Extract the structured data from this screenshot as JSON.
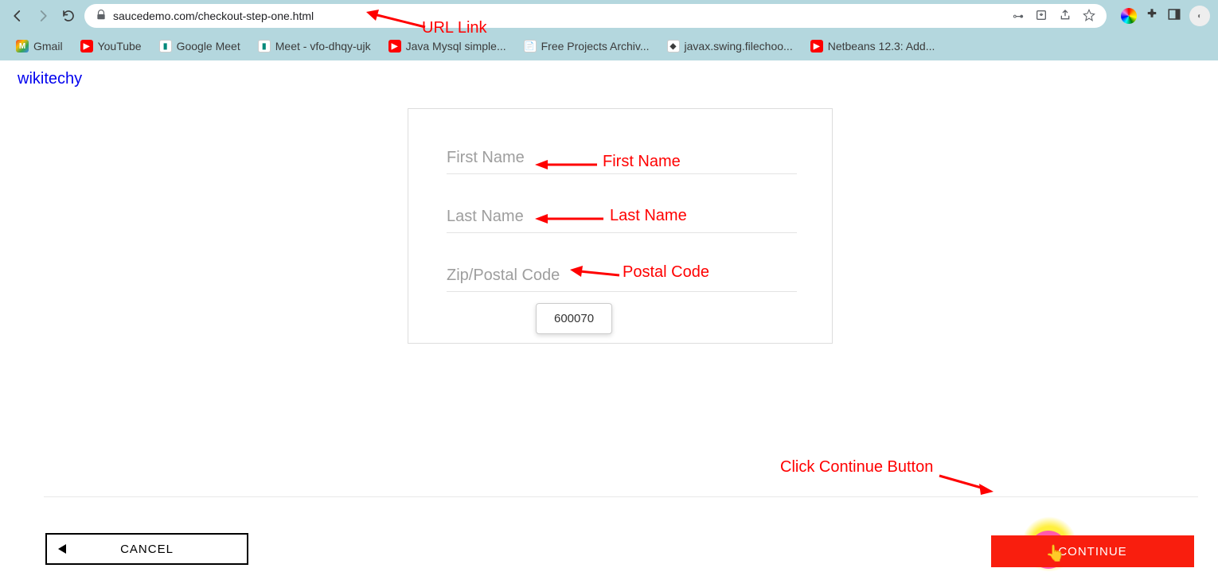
{
  "browser": {
    "url": "saucedemo.com/checkout-step-one.html",
    "bookmarks": [
      {
        "label": "Gmail"
      },
      {
        "label": "YouTube"
      },
      {
        "label": "Google Meet"
      },
      {
        "label": "Meet - vfo-dhqy-ujk"
      },
      {
        "label": "Java Mysql simple..."
      },
      {
        "label": "Free Projects Archiv..."
      },
      {
        "label": "javax.swing.filechoo..."
      },
      {
        "label": "Netbeans 12.3: Add..."
      }
    ]
  },
  "page": {
    "brand_link": "wikitechy",
    "form": {
      "first_name_placeholder": "First Name",
      "last_name_placeholder": "Last Name",
      "zip_placeholder": "Zip/Postal Code",
      "autofill_suggestion": "600070"
    },
    "cancel_label": "CANCEL",
    "continue_label": "CONTINUE"
  },
  "annotations": {
    "url": "URL Link",
    "first": "First Name",
    "last": "Last Name",
    "postal": "Postal Code",
    "cont": "Click Continue Button"
  }
}
